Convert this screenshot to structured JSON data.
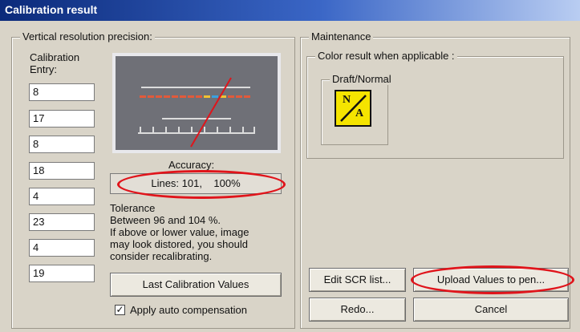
{
  "window": {
    "title": "Calibration result"
  },
  "left_panel": {
    "legend": "Vertical resolution precision:",
    "entry_label": "Calibration\nEntry:",
    "entries": [
      "8",
      "17",
      "8",
      "18",
      "4",
      "23",
      "4",
      "19"
    ],
    "accuracy_label": "Accuracy:",
    "accuracy_value": "Lines: 101,    100%",
    "tolerance_text": "Tolerance\nBetween 96 and 104 %.\nIf above or lower value, image\nmay look distored, you should\nconsider recalibrating.",
    "last_values_button": "Last Calibration Values",
    "auto_comp_label": "Apply auto compensation",
    "auto_comp_checked": true
  },
  "right_panel": {
    "legend": "Maintenance",
    "color_legend": "Color result when applicable :",
    "draft_legend": "Draft/Normal",
    "na_top": "N",
    "na_bottom": "A",
    "edit_scr_button": "Edit SCR list...",
    "upload_button": "Upload Values to pen...",
    "redo_button": "Redo...",
    "cancel_button": "Cancel"
  },
  "colors": {
    "annotation": "#e0141b",
    "na_yellow": "#f5e400"
  }
}
